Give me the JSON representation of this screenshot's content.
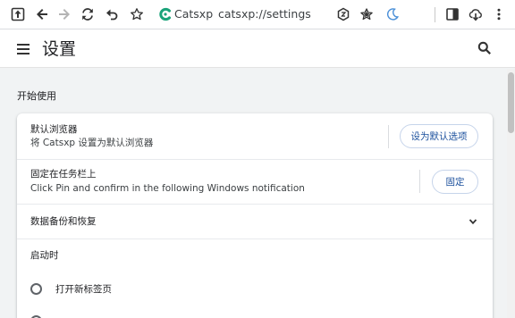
{
  "toolbar": {
    "brand_name": "Catsxp",
    "url": "catsxp://settings"
  },
  "header": {
    "title": "设置"
  },
  "section": {
    "title": "开始使用"
  },
  "default_browser": {
    "title": "默认浏览器",
    "subtitle": "将 Catsxp 设置为默认浏览器",
    "button": "设为默认选项"
  },
  "pin_taskbar": {
    "title": "固定在任务栏上",
    "subtitle": "Click Pin and confirm in the following Windows notification",
    "button": "固定"
  },
  "backup": {
    "title": "数据备份和恢复"
  },
  "startup": {
    "title": "启动时",
    "options": [
      "打开新标签页"
    ]
  },
  "colors": {
    "accent": "#1a4f9c",
    "brand": "#1ba37a"
  }
}
